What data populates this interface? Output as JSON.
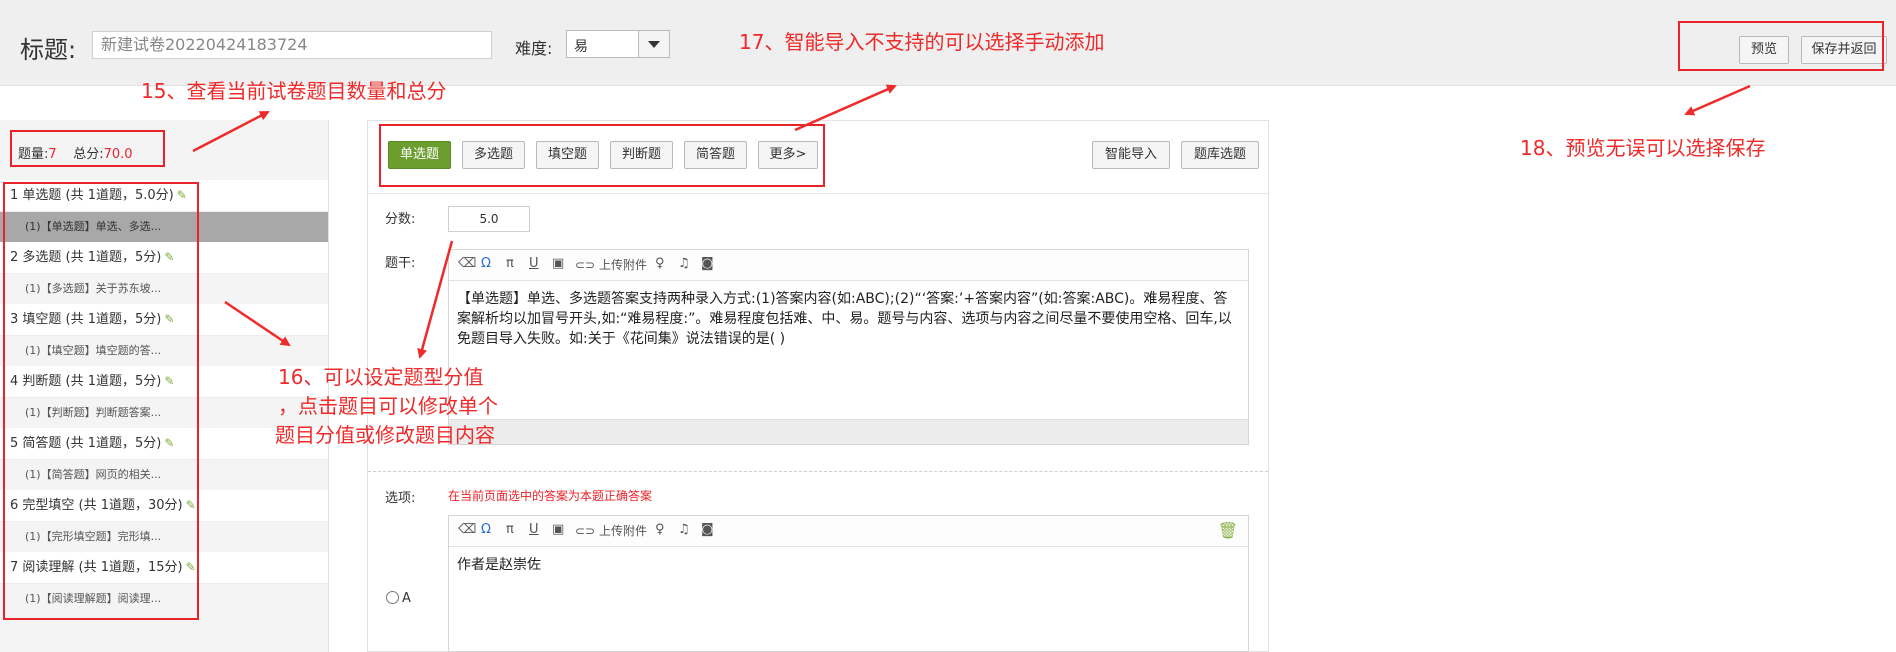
{
  "header": {
    "title_label": "标题:",
    "title_value": "新建试卷20220424183724",
    "difficulty_label": "难度:",
    "difficulty_value": "易",
    "preview_label": "预览",
    "save_label": "保存并返回"
  },
  "stats": {
    "count_label": "题量:",
    "count_value": "7",
    "score_label": "总分:",
    "score_value": "70.0"
  },
  "question_groups": [
    {
      "title": "1 单选题 (共 1道题，5.0分)",
      "item": "(1)【单选题】单选、多选..."
    },
    {
      "title": "2 多选题 (共 1道题，5分)",
      "item": "(1)【多选题】关于苏东坡..."
    },
    {
      "title": "3 填空题 (共 1道题，5分)",
      "item": "(1)【填空题】填空题的答..."
    },
    {
      "title": "4 判断题 (共 1道题，5分)",
      "item": "(1)【判断题】判断题答案..."
    },
    {
      "title": "5 简答题 (共 1道题，5分)",
      "item": "(1)【简答题】网页的相关..."
    },
    {
      "title": "6 完型填空 (共 1道题，30分)",
      "item": "(1)【完形填空题】完形填..."
    },
    {
      "title": "7 阅读理解 (共 1道题，15分)",
      "item": "(1)【阅读理解题】阅读理..."
    }
  ],
  "type_tabs": [
    "单选题",
    "多选题",
    "填空题",
    "判断题",
    "简答题",
    "更多>"
  ],
  "import_buttons": {
    "smart": "智能导入",
    "bank": "题库选题"
  },
  "editor": {
    "score_label": "分数:",
    "score_value": "5.0",
    "stem_label": "题干:",
    "upload_label": "上传附件",
    "stem_text": "【单选题】单选、多选题答案支持两种录入方式:(1)答案内容(如:ABC);(2)“‘答案:’+答案内容”(如:答案:ABC)。难易程度、答案解析均以加冒号开头,如:“难易程度:”。难易程度包括难、中、易。题号与内容、选项与内容之间尽量不要使用空格、回车,以免题目导入失败。如:关于《花间集》说法错误的是( )",
    "options_label": "选项:",
    "options_hint": "在当前页面选中的答案为本题正确答案",
    "option_a_label": "A",
    "option_a_text": "作者是赵崇佐"
  },
  "annotations": {
    "a15": "15、查看当前试卷题目数量和总分",
    "a16_line1": "16、可以设定题型分值",
    "a16_line2": "，点击题目可以修改单个",
    "a16_line3": "题目分值或修改题目内容",
    "a17": "17、智能导入不支持的可以选择手动添加",
    "a18": "18、预览无误可以选择保存"
  },
  "colors": {
    "accent_green": "#6b9e2e",
    "annotation_red": "#ee2a2a",
    "selected_gray": "#a8a8a8"
  }
}
